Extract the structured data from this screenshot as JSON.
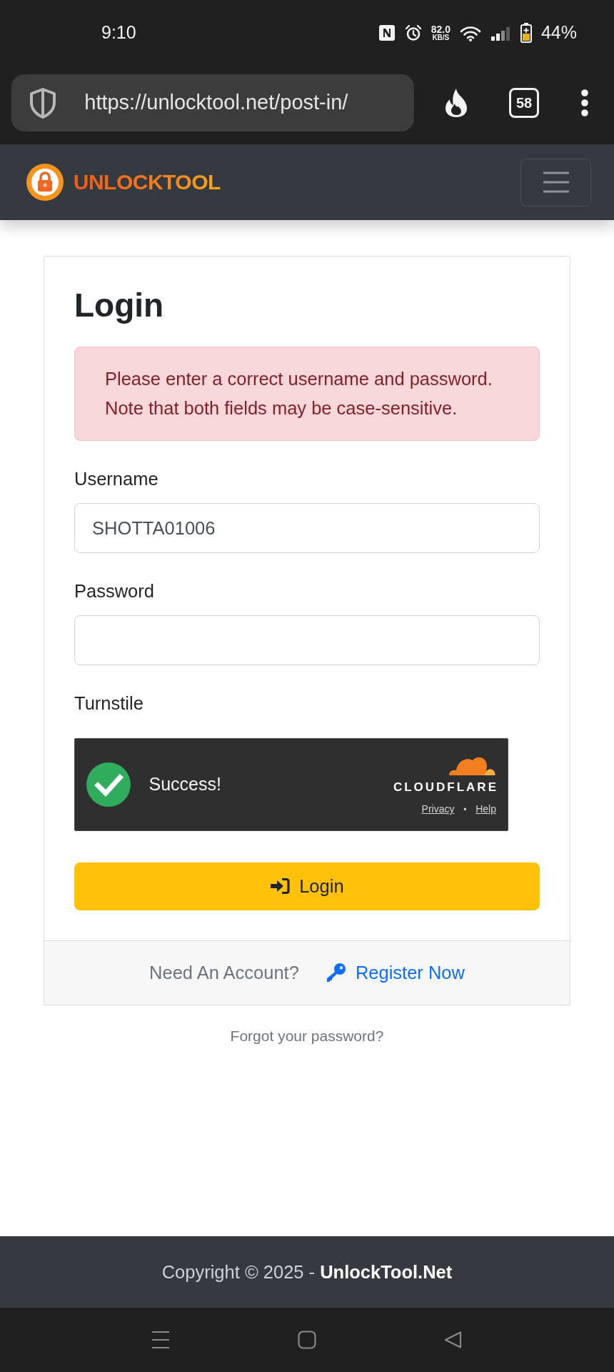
{
  "status_bar": {
    "time": "9:10",
    "speed_value": "82.0",
    "speed_unit": "KB/S",
    "battery": "44%"
  },
  "browser_toolbar": {
    "url": "https://unlocktool.net/post-in/",
    "tab_count": "58"
  },
  "navbar": {
    "logo_text": "UNLOCKTOOL"
  },
  "login_card": {
    "title": "Login",
    "alert": "Please enter a correct username and password. Note that both fields may be case-sensitive.",
    "fields": [
      {
        "kind": "text",
        "label": "Username",
        "value": "SHOTTA01006"
      },
      {
        "kind": "password",
        "label": "Password"
      }
    ],
    "turnstile": {
      "label": "Turnstile",
      "verified": true,
      "status": "Success!",
      "brand": "CLOUDFLARE",
      "links": [
        "Privacy",
        "Help"
      ],
      "separator": "•"
    },
    "submit_button": {
      "label": "Login"
    },
    "footer": {
      "prompt": "Need An Account?",
      "link": "Register Now"
    }
  },
  "forgot_link": "Forgot your password?",
  "page_footer": {
    "text": "Copyright © 2025 - **UnlockTool.Net**"
  }
}
